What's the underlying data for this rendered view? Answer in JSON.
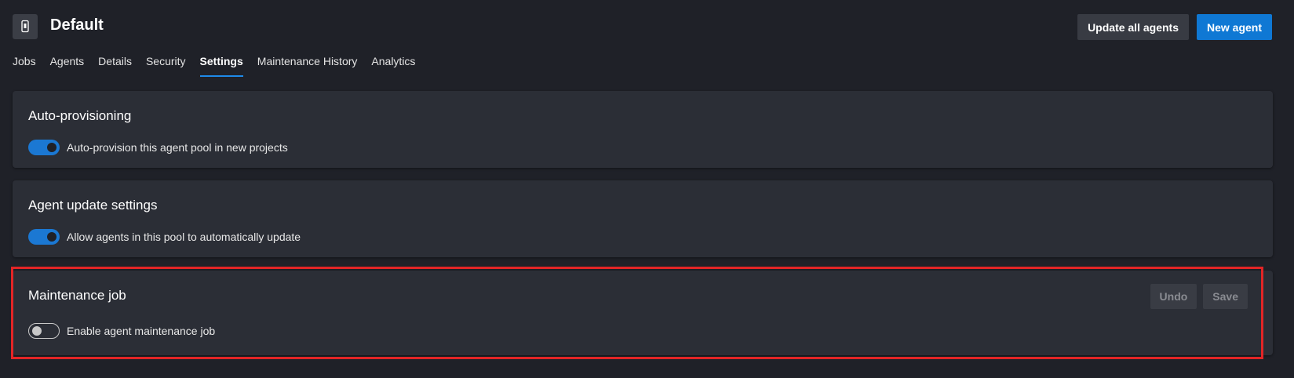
{
  "header": {
    "pool_icon": "phone-icon",
    "title": "Default",
    "update_all_label": "Update all agents",
    "new_agent_label": "New agent"
  },
  "tabs": [
    {
      "label": "Jobs",
      "active": false
    },
    {
      "label": "Agents",
      "active": false
    },
    {
      "label": "Details",
      "active": false
    },
    {
      "label": "Security",
      "active": false
    },
    {
      "label": "Settings",
      "active": true
    },
    {
      "label": "Maintenance History",
      "active": false
    },
    {
      "label": "Analytics",
      "active": false
    }
  ],
  "sections": {
    "auto_provisioning": {
      "title": "Auto-provisioning",
      "toggle_label": "Auto-provision this agent pool in new projects",
      "toggle_on": true
    },
    "agent_update": {
      "title": "Agent update settings",
      "toggle_label": "Allow agents in this pool to automatically update",
      "toggle_on": true
    },
    "maintenance_job": {
      "title": "Maintenance job",
      "toggle_label": "Enable agent maintenance job",
      "toggle_on": false,
      "undo_label": "Undo",
      "save_label": "Save"
    }
  },
  "colors": {
    "background": "#1f2128",
    "card": "#2b2e36",
    "accent": "#0f78d4",
    "highlight": "#e32526"
  }
}
